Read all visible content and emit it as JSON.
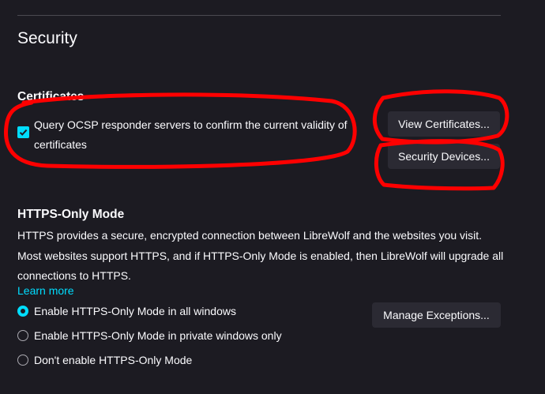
{
  "section": {
    "title": "Security"
  },
  "certificates": {
    "heading": "Certificates",
    "ocsp_label": "Query OCSP responder servers to confirm the current validity of certificates",
    "ocsp_checked": true,
    "view_button": "View Certificates...",
    "devices_button": "Security Devices..."
  },
  "https_only": {
    "heading": "HTTPS-Only Mode",
    "description": "HTTPS provides a secure, encrypted connection between LibreWolf and the websites you visit. Most websites support HTTPS, and if HTTPS-Only Mode is enabled, then LibreWolf will upgrade all connections to HTTPS.",
    "learn_more": "Learn more",
    "options": [
      {
        "label": "Enable HTTPS-Only Mode in all windows",
        "selected": true
      },
      {
        "label": "Enable HTTPS-Only Mode in private windows only",
        "selected": false
      },
      {
        "label": "Don't enable HTTPS-Only Mode",
        "selected": false
      }
    ],
    "exceptions_button": "Manage Exceptions..."
  },
  "colors": {
    "background": "#1c1b22",
    "accent": "#00ddff",
    "button": "#2b2a33",
    "annotation": "#ff0000"
  }
}
